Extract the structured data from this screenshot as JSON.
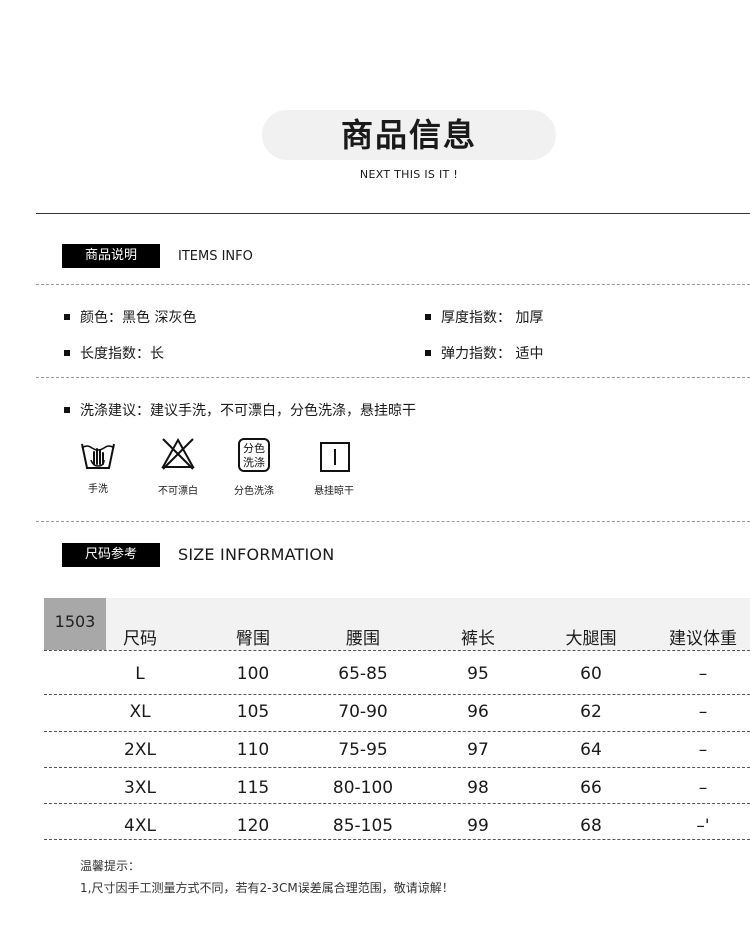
{
  "header": {
    "title": "商品信息",
    "subtitle": "NEXT THIS IS IT !"
  },
  "items_section": {
    "tag": "商品说明",
    "tag_en": "ITEMS INFO",
    "attributes": [
      {
        "text": "颜色：黑色  深灰色"
      },
      {
        "text": "厚度指数：  加厚"
      },
      {
        "text": "长度指数：长"
      },
      {
        "text": "弹力指数：  适中"
      }
    ],
    "wash_advice": "洗涤建议：建议手洗，不可漂白，分色洗涤，悬挂晾干",
    "care_icons": [
      {
        "icon": "hand-wash-icon",
        "label": "手洗"
      },
      {
        "icon": "no-bleach-icon",
        "label": "不可漂白"
      },
      {
        "icon": "separate-wash-icon",
        "label": "分色洗涤",
        "glyph_top": "分色",
        "glyph_bottom": "洗涤"
      },
      {
        "icon": "hang-dry-icon",
        "label": "悬挂晾干"
      }
    ]
  },
  "size_section": {
    "tag": "尺码参考",
    "tag_en": "SIZE INFORMATION",
    "model": "1503",
    "columns": [
      "尺码",
      "臀围",
      "腰围",
      "裤长",
      "大腿围",
      "建议体重"
    ],
    "rows": [
      [
        "L",
        "100",
        "65-85",
        "95",
        "60",
        "–"
      ],
      [
        "XL",
        "105",
        "70-90",
        "96",
        "62",
        "–"
      ],
      [
        "2XL",
        "110",
        "75-95",
        "97",
        "64",
        "–"
      ],
      [
        "3XL",
        "115",
        "80-100",
        "98",
        "66",
        "–"
      ],
      [
        "4XL",
        "120",
        "85-105",
        "99",
        "68",
        "–'"
      ]
    ]
  },
  "notes": {
    "title": "温馨提示：",
    "line1": "1,尺寸因手工测量方式不同，若有2-3CM误差属合理范围，敬请谅解！"
  }
}
